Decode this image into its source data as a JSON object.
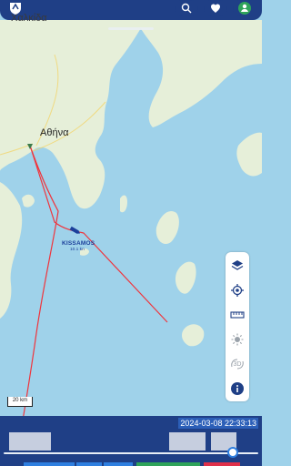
{
  "map": {
    "top_place": "Χαλκίδα",
    "city": "Αθήνα",
    "scale": "20 km"
  },
  "vessel": {
    "name": "KISSAMOS",
    "speed": "10.1 kn"
  },
  "timeline": {
    "timestamp": "2024-03-08 22:33:13",
    "position": 0.9
  },
  "colors": {
    "sea": "#9fd2ea",
    "land": "#e6efd9",
    "track": "#f0343c",
    "topbar": "#1f3f86",
    "vessel": "#1c3f9a"
  },
  "icons": {
    "logo": "app-logo-icon",
    "search": "search-icon",
    "favorite": "heart-icon",
    "user": "user-icon",
    "layers": "layers-icon",
    "locate": "locate-icon",
    "measure": "ruler-icon",
    "daylight": "sun-icon",
    "view3d": "3d-rotate-icon",
    "info": "info-icon"
  },
  "toolbar": {
    "view3d_label": "3D"
  }
}
